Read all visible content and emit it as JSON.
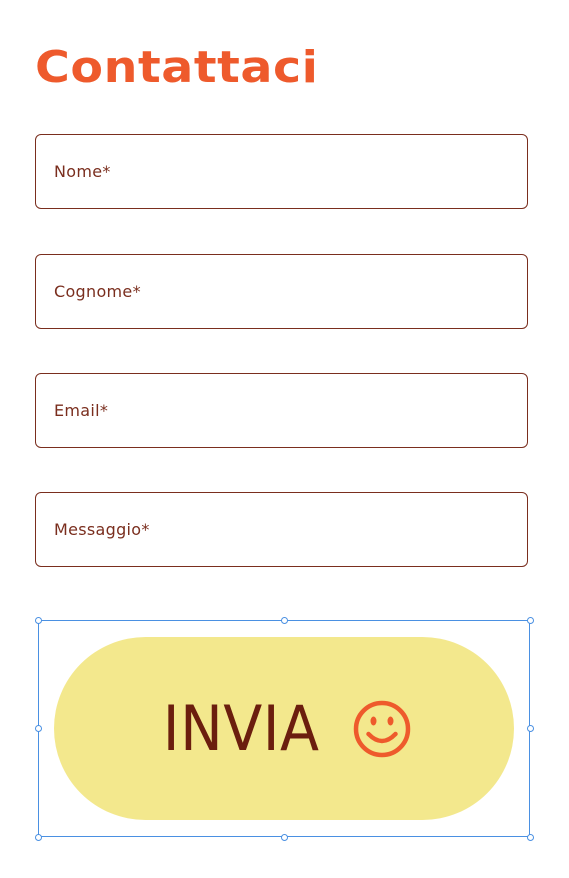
{
  "title": "Contattaci",
  "fields": {
    "nome": "Nome*",
    "cognome": "Cognome*",
    "email": "Email*",
    "messaggio": "Messaggio*"
  },
  "submit": {
    "label": "INVIA",
    "icon": "smile-icon"
  },
  "colors": {
    "accent": "#ee5a2c",
    "border": "#7a2e1e",
    "button_bg": "#f3e88d",
    "button_text": "#6b1e0e",
    "selection": "#4a90e2"
  }
}
